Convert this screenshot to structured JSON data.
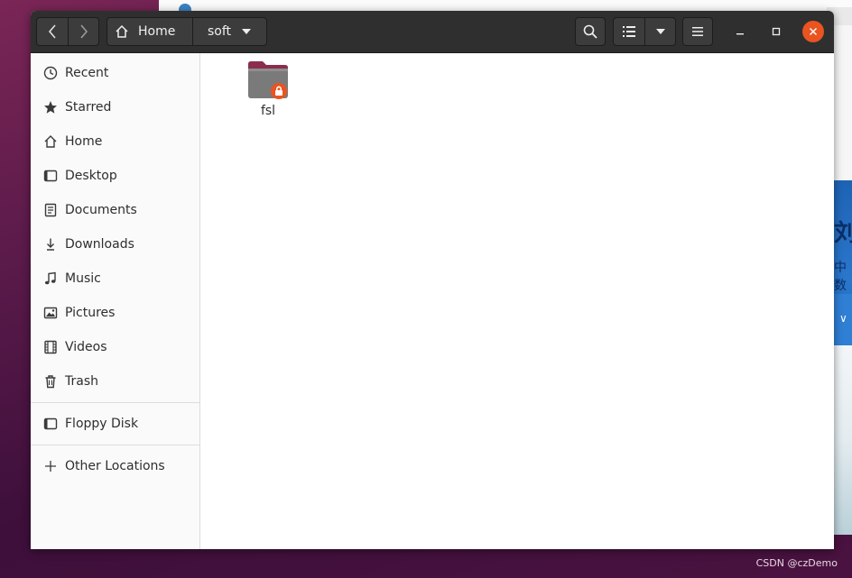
{
  "window": {
    "breadcrumb": [
      {
        "label": "Home",
        "icon": "home-icon"
      },
      {
        "label": "soft",
        "icon": "chevron-down-icon"
      }
    ]
  },
  "sidebar": {
    "items": [
      {
        "label": "Recent",
        "icon": "clock-icon"
      },
      {
        "label": "Starred",
        "icon": "star-icon"
      },
      {
        "label": "Home",
        "icon": "home-icon"
      },
      {
        "label": "Desktop",
        "icon": "desktop-icon"
      },
      {
        "label": "Documents",
        "icon": "document-icon"
      },
      {
        "label": "Downloads",
        "icon": "download-icon"
      },
      {
        "label": "Music",
        "icon": "music-note-icon"
      },
      {
        "label": "Pictures",
        "icon": "picture-icon"
      },
      {
        "label": "Videos",
        "icon": "film-icon"
      },
      {
        "label": "Trash",
        "icon": "trash-icon"
      }
    ],
    "devices": [
      {
        "label": "Floppy Disk",
        "icon": "drive-icon"
      }
    ],
    "other": [
      {
        "label": "Other Locations",
        "icon": "plus-icon"
      }
    ]
  },
  "content": {
    "files": [
      {
        "name": "fsl",
        "icon": "locked-folder-icon"
      }
    ]
  },
  "colors": {
    "headerbar": "#2f2f2f",
    "accent": "#e95420",
    "folder": "#7a7a7a",
    "folder_tab": "#8b2d4b"
  },
  "background_app": {
    "cn_text_1": "刘",
    "cn_text_2": "中数"
  },
  "watermark": "CSDN @czDemo"
}
